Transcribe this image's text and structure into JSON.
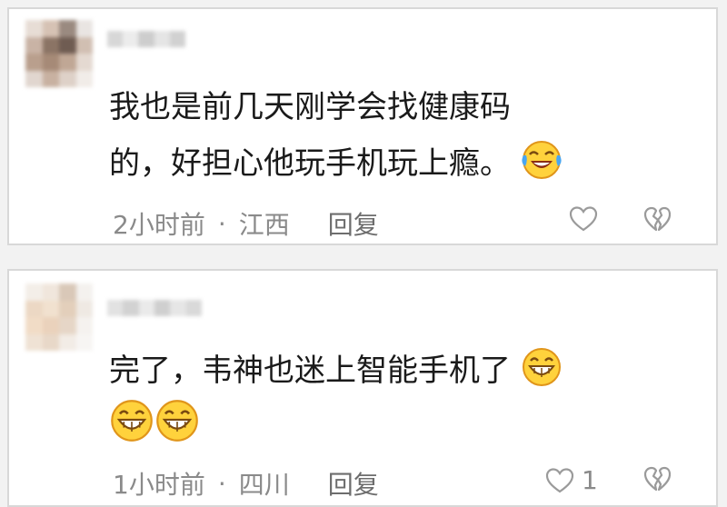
{
  "comments": [
    {
      "line1": "我也是前几天刚学会找健康码",
      "line2": "的，好担心他玩手机玩上瘾。",
      "emoji": "laughing-tears-emoji",
      "time": "2小时前",
      "dot": "·",
      "location": "江西",
      "reply": "回复",
      "likes": ""
    },
    {
      "line1": "完了，韦神也迷上智能手机了",
      "line2": "",
      "emoji": "grinning-emoji",
      "time": "1小时前",
      "dot": "·",
      "location": "四川",
      "reply": "回复",
      "likes": "1"
    }
  ],
  "icons": {
    "like": "heart-outline-icon",
    "dislike": "broken-heart-icon"
  },
  "colors": {
    "text": "#1a1a1a",
    "meta": "#8a8a8a",
    "emoji_face": "#ffd23c",
    "emoji_outline": "#e0951a"
  }
}
